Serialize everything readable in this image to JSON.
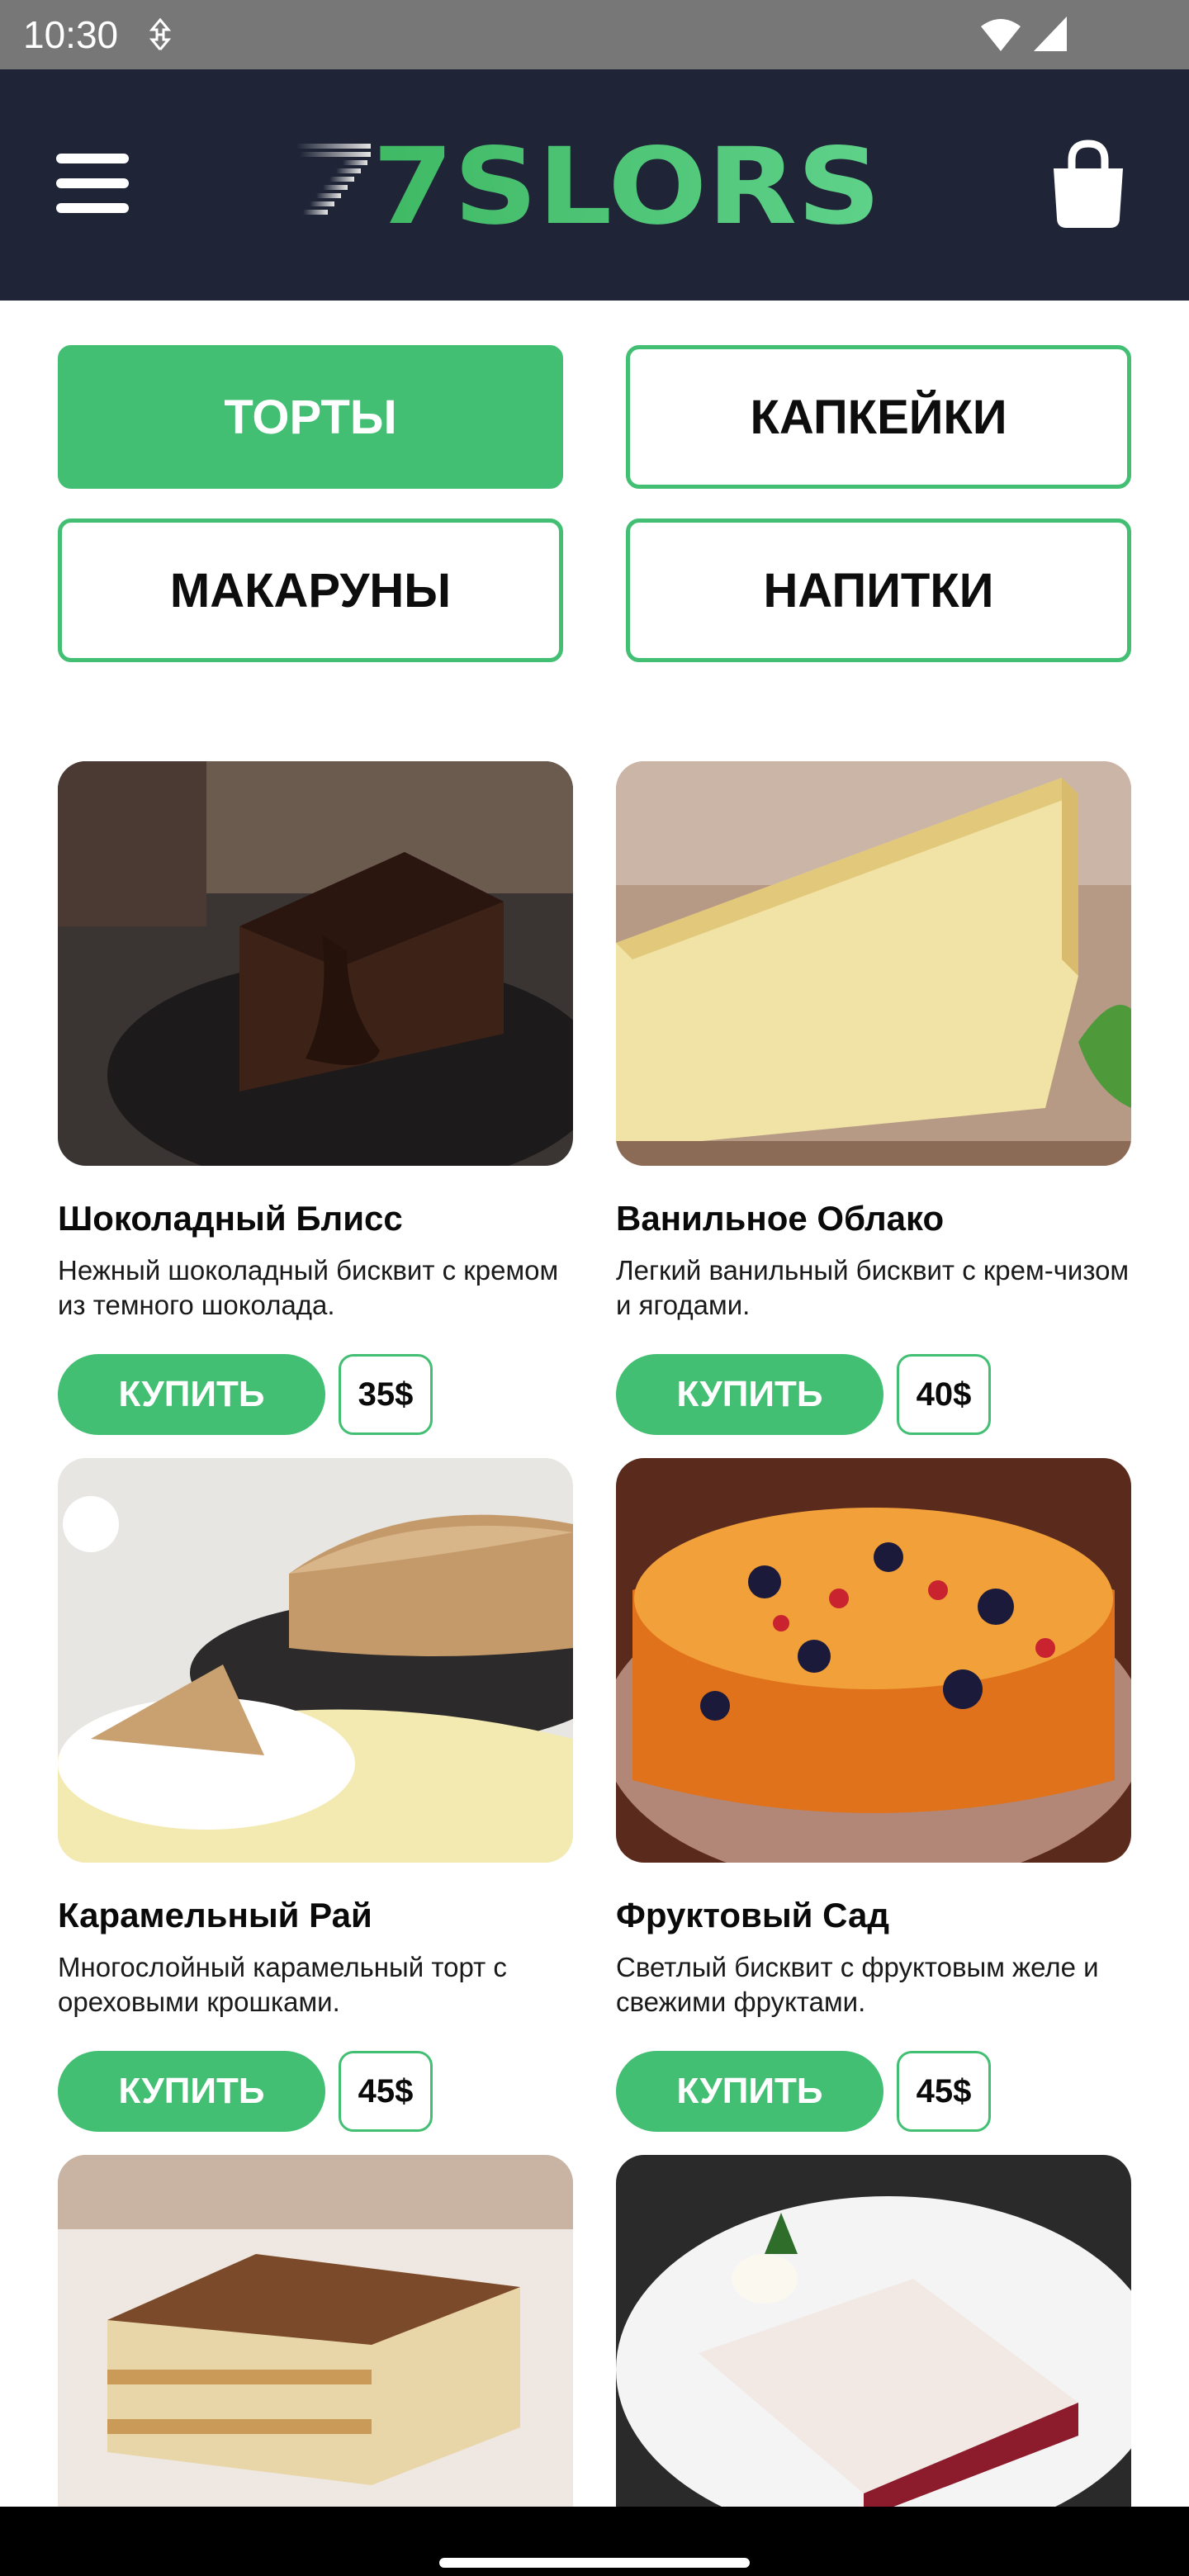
{
  "status_bar": {
    "time": "10:30",
    "icons": [
      "data-saver-icon",
      "wifi-icon",
      "signal-icon"
    ]
  },
  "header": {
    "logo_text": "7SLORS",
    "menu_icon": "hamburger-menu-icon",
    "cart_icon": "shopping-bag-icon"
  },
  "categories": [
    {
      "label": "ТОРТЫ",
      "active": true
    },
    {
      "label": "КАПКЕЙКИ",
      "active": false
    },
    {
      "label": "МАКАРУНЫ",
      "active": false
    },
    {
      "label": "НАПИТКИ",
      "active": false
    }
  ],
  "products": [
    {
      "title": "Шоколадный Блисс",
      "description": "Нежный шоколадный бисквит с кремом из темного шоколада.",
      "buy_label": "КУПИТЬ",
      "price": "35$"
    },
    {
      "title": "Ванильное Облако",
      "description": "Легкий ванильный бисквит с крем-чизом и ягодами.",
      "buy_label": "КУПИТЬ",
      "price": "40$"
    },
    {
      "title": "Карамельный Рай",
      "description": "Многослойный карамельный торт с ореховыми крошками.",
      "buy_label": "КУПИТЬ",
      "price": "45$"
    },
    {
      "title": "Фруктовый Сад",
      "description": "Светлый бисквит с фруктовым желе и свежими фруктами.",
      "buy_label": "КУПИТЬ",
      "price": "45$"
    }
  ],
  "colors": {
    "accent": "#42bf73",
    "header_bg": "#1f2537",
    "status_bar_bg": "#777777",
    "nav_bar_bg": "#000000"
  }
}
